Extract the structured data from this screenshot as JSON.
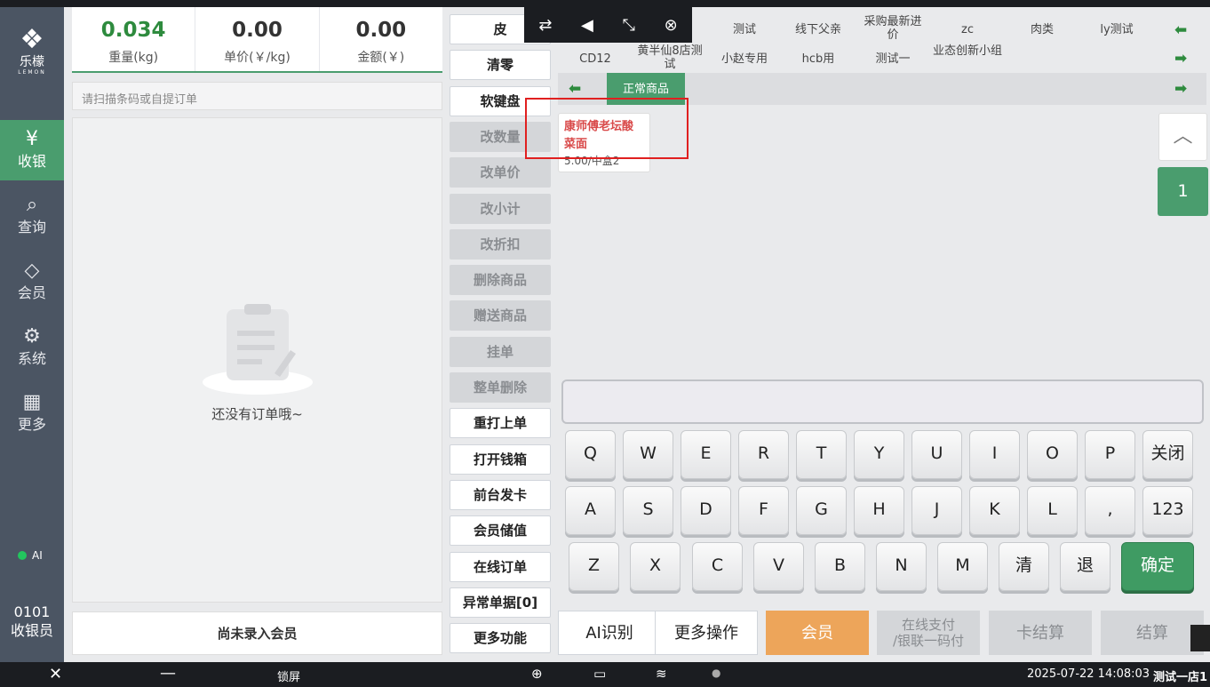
{
  "brand": {
    "mark": "❖",
    "name_cn": "乐檬",
    "name_en": "LEMON"
  },
  "sidebar": {
    "items": [
      {
        "label": "收银",
        "icon": "cashier-icon",
        "active": true
      },
      {
        "label": "查询",
        "icon": "query-icon"
      },
      {
        "label": "会员",
        "icon": "member-icon"
      },
      {
        "label": "系统",
        "icon": "settings-icon"
      },
      {
        "label": "更多",
        "icon": "grid-icon"
      }
    ],
    "ai_label": "AI",
    "operator_id": "0101",
    "operator_role": "收银员"
  },
  "scale": {
    "weight": "0.034",
    "weight_label": "重量(kg)",
    "unit_price": "0.00",
    "unit_price_label": "单价(￥/kg)",
    "amount": "0.00",
    "amount_label": "金额(￥)"
  },
  "scan": {
    "placeholder": "请扫描条码或自提订单"
  },
  "order": {
    "empty_text": "还没有订单哦~"
  },
  "member_bar": "尚未录入会员",
  "func_buttons": [
    {
      "label": "皮",
      "enabled": true
    },
    {
      "label": "清零",
      "enabled": true
    },
    {
      "label": "软键盘",
      "enabled": true
    },
    {
      "label": "改数量",
      "enabled": false
    },
    {
      "label": "改单价",
      "enabled": false
    },
    {
      "label": "改小计",
      "enabled": false
    },
    {
      "label": "改折扣",
      "enabled": false
    },
    {
      "label": "删除商品",
      "enabled": false
    },
    {
      "label": "赠送商品",
      "enabled": false
    },
    {
      "label": "挂单",
      "enabled": false
    },
    {
      "label": "整单删除",
      "enabled": false
    },
    {
      "label": "重打上单",
      "enabled": true
    },
    {
      "label": "打开钱箱",
      "enabled": true
    },
    {
      "label": "前台发卡",
      "enabled": true
    },
    {
      "label": "会员储值",
      "enabled": true
    },
    {
      "label": "在线订单",
      "enabled": true
    },
    {
      "label": "异常单据[0]",
      "enabled": true
    },
    {
      "label": "更多功能",
      "enabled": true
    }
  ],
  "floatbar": {
    "icons": [
      "swap-icon",
      "play-icon",
      "resize-icon",
      "close-circle-icon"
    ]
  },
  "categories_row1": [
    "测试",
    "线下父亲",
    "采购最新进价",
    "zc",
    "肉类",
    "ly测试"
  ],
  "categories_row2": [
    "CD12",
    "黄半仙8店测试",
    "小赵专用",
    "hcb用",
    "测试一",
    "业态创新小组"
  ],
  "category_tab": "正常商品",
  "product": {
    "name": "康师傅老坛酸菜面",
    "price": "5.00/中盒2"
  },
  "pagination": {
    "page": "1"
  },
  "keyboard": {
    "row1": [
      "Q",
      "W",
      "E",
      "R",
      "T",
      "Y",
      "U",
      "I",
      "O",
      "P",
      "关闭"
    ],
    "row2": [
      "A",
      "S",
      "D",
      "F",
      "G",
      "H",
      "J",
      "K",
      "L",
      ",",
      "123"
    ],
    "row3": [
      "Z",
      "X",
      "C",
      "V",
      "B",
      "N",
      "M",
      "清",
      "退"
    ],
    "confirm": "确定"
  },
  "bottom_buttons": [
    {
      "label": "AI识别",
      "style": "normal"
    },
    {
      "label": "更多操作",
      "style": "normal"
    },
    {
      "label": "会员",
      "style": "orange"
    },
    {
      "label": "在线支付\n/银联一码付",
      "style": "disabled"
    },
    {
      "label": "卡结算",
      "style": "disabled"
    },
    {
      "label": "结算",
      "style": "disabled"
    }
  ],
  "taskbar": {
    "lock": "锁屏",
    "datetime": "2025-07-22 14:08:03",
    "store": "测试一店1"
  },
  "colors": {
    "accent": "#4a9d6e",
    "sidebar": "#4b5563",
    "orange": "#eda55a",
    "highlight": "#e02020"
  }
}
